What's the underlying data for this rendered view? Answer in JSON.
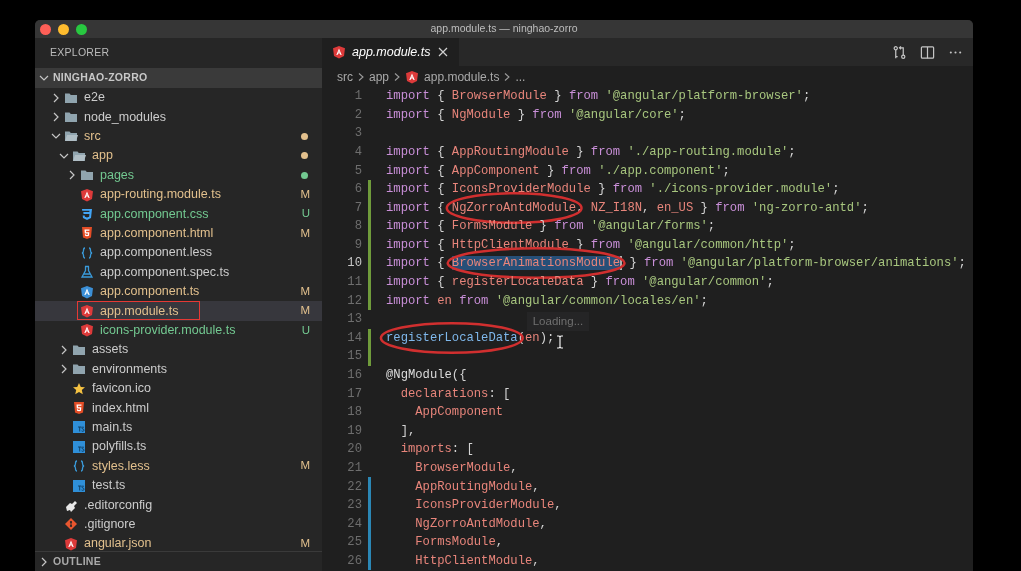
{
  "window": {
    "title": "app.module.ts — ninghao-zorro"
  },
  "sidebar": {
    "title": "EXPLORER",
    "root": {
      "name": "NINGHAO-ZORRO",
      "expanded": true,
      "children": [
        {
          "name": "e2e",
          "kind": "folder",
          "expanded": false,
          "selected": false
        },
        {
          "name": "node_modules",
          "kind": "folder",
          "expanded": false,
          "selected": false
        },
        {
          "name": "src",
          "kind": "folder",
          "expanded": true,
          "selected": false,
          "color": "#e2c08d",
          "children": [
            {
              "name": "app",
              "kind": "folder",
              "expanded": true,
              "selected": false,
              "color": "#e2c08d",
              "children": [
                {
                  "name": "pages",
                  "kind": "folder",
                  "expanded": false,
                  "selected": false,
                  "color": "#73c991"
                },
                {
                  "name": "app-routing.module.ts",
                  "kind": "angular",
                  "selected": false,
                  "color": "#e2c08d",
                  "badge": "M"
                },
                {
                  "name": "app.component.css",
                  "kind": "css",
                  "selected": false,
                  "color": "#73c991",
                  "badge": "U"
                },
                {
                  "name": "app.component.html",
                  "kind": "html",
                  "selected": false,
                  "color": "#e2c08d",
                  "badge": "M"
                },
                {
                  "name": "app.component.less",
                  "kind": "braces",
                  "selected": false
                },
                {
                  "name": "app.component.spec.ts",
                  "kind": "flask",
                  "selected": false
                },
                {
                  "name": "app.component.ts",
                  "kind": "angular-blue",
                  "selected": false,
                  "color": "#e2c08d",
                  "badge": "M"
                },
                {
                  "name": "app.module.ts",
                  "kind": "angular",
                  "selected": true,
                  "boxed": true,
                  "color": "#e2c08d",
                  "badge": "M"
                },
                {
                  "name": "icons-provider.module.ts",
                  "kind": "angular",
                  "selected": false,
                  "color": "#73c991",
                  "badge": "U"
                }
              ]
            },
            {
              "name": "assets",
              "kind": "folder",
              "expanded": false,
              "selected": false
            },
            {
              "name": "environments",
              "kind": "folder",
              "expanded": false,
              "selected": false
            },
            {
              "name": "favicon.ico",
              "kind": "star",
              "selected": false
            },
            {
              "name": "index.html",
              "kind": "html",
              "selected": false
            },
            {
              "name": "main.ts",
              "kind": "ts",
              "selected": false
            },
            {
              "name": "polyfills.ts",
              "kind": "ts",
              "selected": false
            },
            {
              "name": "styles.less",
              "kind": "braces",
              "selected": false,
              "color": "#e2c08d",
              "badge": "M"
            },
            {
              "name": "test.ts",
              "kind": "ts",
              "selected": false
            }
          ]
        },
        {
          "name": ".editorconfig",
          "kind": "config",
          "selected": false
        },
        {
          "name": ".gitignore",
          "kind": "git",
          "selected": false
        },
        {
          "name": "angular.json",
          "kind": "angular",
          "selected": false,
          "color": "#e2c08d",
          "badge": "M"
        }
      ]
    },
    "outline": {
      "title": "OUTLINE",
      "expanded": false
    }
  },
  "editor": {
    "tabs": [
      {
        "label": "app.module.ts",
        "kind": "angular",
        "selected": true,
        "preview": true
      }
    ],
    "breadcrumb": [
      {
        "text": "src"
      },
      {
        "text": "app"
      },
      {
        "text": "app.module.ts",
        "kind": "angular"
      },
      {
        "text": "..."
      }
    ],
    "lines": [
      {
        "number": "1",
        "kind": "unchanged",
        "current": false,
        "tokens": [
          {
            "kind": "kw",
            "text": "import"
          },
          {
            "kind": "p",
            "text": " { "
          },
          {
            "kind": "id",
            "text": "BrowserModule"
          },
          {
            "kind": "p",
            "text": " } "
          },
          {
            "kind": "kw",
            "text": "from "
          },
          {
            "kind": "str",
            "text": "'@angular/platform-browser'"
          },
          {
            "kind": "p",
            "text": ";"
          }
        ]
      },
      {
        "number": "2",
        "kind": "unchanged",
        "current": false,
        "tokens": [
          {
            "kind": "kw",
            "text": "import"
          },
          {
            "kind": "p",
            "text": " { "
          },
          {
            "kind": "id",
            "text": "NgModule"
          },
          {
            "kind": "p",
            "text": " } "
          },
          {
            "kind": "kw",
            "text": "from "
          },
          {
            "kind": "str",
            "text": "'@angular/core'"
          },
          {
            "kind": "p",
            "text": ";"
          }
        ]
      },
      {
        "number": "3",
        "kind": "unchanged",
        "current": false
      },
      {
        "number": "4",
        "kind": "unchanged",
        "current": false,
        "tokens": [
          {
            "kind": "kw",
            "text": "import"
          },
          {
            "kind": "p",
            "text": " { "
          },
          {
            "kind": "id",
            "text": "AppRoutingModule"
          },
          {
            "kind": "p",
            "text": " } "
          },
          {
            "kind": "kw",
            "text": "from "
          },
          {
            "kind": "str",
            "text": "'./app-routing.module'"
          },
          {
            "kind": "p",
            "text": ";"
          }
        ]
      },
      {
        "number": "5",
        "kind": "unchanged",
        "current": false,
        "tokens": [
          {
            "kind": "kw",
            "text": "import"
          },
          {
            "kind": "p",
            "text": " { "
          },
          {
            "kind": "id",
            "text": "AppComponent"
          },
          {
            "kind": "p",
            "text": " } "
          },
          {
            "kind": "kw",
            "text": "from "
          },
          {
            "kind": "str",
            "text": "'./app.component'"
          },
          {
            "kind": "p",
            "text": ";"
          }
        ]
      },
      {
        "number": "6",
        "kind": "added",
        "current": false,
        "tokens": [
          {
            "kind": "kw",
            "text": "import"
          },
          {
            "kind": "p",
            "text": " { "
          },
          {
            "kind": "id",
            "text": "IconsProviderModule"
          },
          {
            "kind": "p",
            "text": " } "
          },
          {
            "kind": "kw",
            "text": "from "
          },
          {
            "kind": "str",
            "text": "'./icons-provider.module'"
          },
          {
            "kind": "p",
            "text": ";"
          }
        ]
      },
      {
        "number": "7",
        "kind": "added",
        "current": false,
        "tokens": [
          {
            "kind": "kw",
            "text": "import"
          },
          {
            "kind": "p",
            "text": " { "
          },
          {
            "kind": "id",
            "text": "NgZorroAntdModule",
            "circled": true
          },
          {
            "kind": "p",
            "text": ", "
          },
          {
            "kind": "id",
            "text": "NZ_I18N"
          },
          {
            "kind": "p",
            "text": ", "
          },
          {
            "kind": "id",
            "text": "en_US"
          },
          {
            "kind": "p",
            "text": " } "
          },
          {
            "kind": "kw",
            "text": "from "
          },
          {
            "kind": "str",
            "text": "'ng-zorro-antd'"
          },
          {
            "kind": "p",
            "text": ";"
          }
        ]
      },
      {
        "number": "8",
        "kind": "added",
        "current": false,
        "tokens": [
          {
            "kind": "kw",
            "text": "import"
          },
          {
            "kind": "p",
            "text": " { "
          },
          {
            "kind": "id",
            "text": "FormsModule"
          },
          {
            "kind": "p",
            "text": " } "
          },
          {
            "kind": "kw",
            "text": "from "
          },
          {
            "kind": "str",
            "text": "'@angular/forms'"
          },
          {
            "kind": "p",
            "text": ";"
          }
        ]
      },
      {
        "number": "9",
        "kind": "added",
        "current": false,
        "tokens": [
          {
            "kind": "kw",
            "text": "import"
          },
          {
            "kind": "p",
            "text": " { "
          },
          {
            "kind": "id",
            "text": "HttpClientModule"
          },
          {
            "kind": "p",
            "text": " } "
          },
          {
            "kind": "kw",
            "text": "from "
          },
          {
            "kind": "str",
            "text": "'@angular/common/http'"
          },
          {
            "kind": "p",
            "text": ";"
          }
        ]
      },
      {
        "number": "10",
        "kind": "added",
        "current": true,
        "tokens": [
          {
            "kind": "kw",
            "text": "import"
          },
          {
            "kind": "p",
            "text": " { "
          },
          {
            "kind": "id",
            "text": "BrowserAnimationsModule",
            "selected": true,
            "circled": true
          },
          {
            "kind": "p",
            "text": " } "
          },
          {
            "kind": "kw",
            "text": "from "
          },
          {
            "kind": "str",
            "text": "'@angular/platform-browser/animations'"
          },
          {
            "kind": "p",
            "text": ";"
          }
        ]
      },
      {
        "number": "11",
        "kind": "added",
        "current": false,
        "tokens": [
          {
            "kind": "kw",
            "text": "import"
          },
          {
            "kind": "p",
            "text": " { "
          },
          {
            "kind": "id",
            "text": "registerLocaleData"
          },
          {
            "kind": "p",
            "text": " } "
          },
          {
            "kind": "kw",
            "text": "from "
          },
          {
            "kind": "str",
            "text": "'@angular/common'"
          },
          {
            "kind": "p",
            "text": ";"
          }
        ]
      },
      {
        "number": "12",
        "kind": "added",
        "current": false,
        "tokens": [
          {
            "kind": "kw",
            "text": "import "
          },
          {
            "kind": "id",
            "text": "en "
          },
          {
            "kind": "kw",
            "text": "from "
          },
          {
            "kind": "str",
            "text": "'@angular/common/locales/en'"
          },
          {
            "kind": "p",
            "text": ";"
          }
        ]
      },
      {
        "number": "13",
        "kind": "unchanged",
        "current": false,
        "tooltip": "Loading..."
      },
      {
        "number": "14",
        "kind": "added",
        "current": false,
        "text_cursor": true,
        "tokens": [
          {
            "kind": "fn",
            "text": "registerLocaleData",
            "circled": true
          },
          {
            "kind": "p",
            "text": "("
          },
          {
            "kind": "id",
            "text": "en"
          },
          {
            "kind": "p",
            "text": ");"
          }
        ]
      },
      {
        "number": "15",
        "kind": "added",
        "current": false
      },
      {
        "number": "16",
        "kind": "unchanged",
        "current": false,
        "tokens": [
          {
            "kind": "deco",
            "text": "@NgModule"
          },
          {
            "kind": "p",
            "text": "({"
          }
        ]
      },
      {
        "number": "17",
        "kind": "unchanged",
        "current": false,
        "tokens": [
          {
            "kind": "id",
            "text": "  declarations"
          },
          {
            "kind": "p",
            "text": ": ["
          }
        ]
      },
      {
        "number": "18",
        "kind": "unchanged",
        "current": false,
        "tokens": [
          {
            "kind": "id",
            "text": "    AppComponent"
          }
        ]
      },
      {
        "number": "19",
        "kind": "unchanged",
        "current": false,
        "tokens": [
          {
            "kind": "p",
            "text": "  ],"
          }
        ]
      },
      {
        "number": "20",
        "kind": "unchanged",
        "current": false,
        "tokens": [
          {
            "kind": "id",
            "text": "  imports"
          },
          {
            "kind": "p",
            "text": ": ["
          }
        ]
      },
      {
        "number": "21",
        "kind": "unchanged",
        "current": false,
        "tokens": [
          {
            "kind": "id",
            "text": "    BrowserModule"
          },
          {
            "kind": "p",
            "text": ","
          }
        ]
      },
      {
        "number": "22",
        "kind": "modified",
        "current": false,
        "tokens": [
          {
            "kind": "id",
            "text": "    AppRoutingModule"
          },
          {
            "kind": "p",
            "text": ","
          }
        ]
      },
      {
        "number": "23",
        "kind": "modified",
        "current": false,
        "tokens": [
          {
            "kind": "id",
            "text": "    IconsProviderModule"
          },
          {
            "kind": "p",
            "text": ","
          }
        ]
      },
      {
        "number": "24",
        "kind": "modified",
        "current": false,
        "tokens": [
          {
            "kind": "id",
            "text": "    NgZorroAntdModule"
          },
          {
            "kind": "p",
            "text": ","
          }
        ]
      },
      {
        "number": "25",
        "kind": "modified",
        "current": false,
        "tokens": [
          {
            "kind": "id",
            "text": "    FormsModule"
          },
          {
            "kind": "p",
            "text": ","
          }
        ]
      },
      {
        "number": "26",
        "kind": "modified",
        "current": false,
        "tokens": [
          {
            "kind": "id",
            "text": "    HttpClientModule"
          },
          {
            "kind": "p",
            "text": ","
          }
        ]
      }
    ]
  }
}
